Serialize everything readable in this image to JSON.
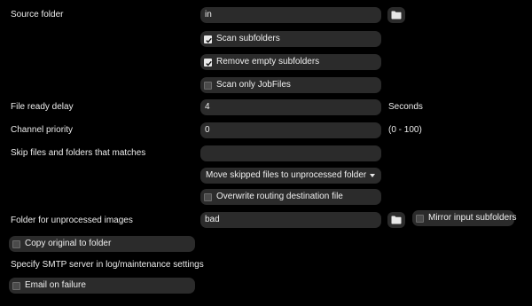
{
  "source_folder": {
    "label": "Source folder",
    "value": "in",
    "browse_icon": "folder-icon"
  },
  "scan_subfolders": {
    "label": "Scan subfolders",
    "checked": true
  },
  "remove_empty_subfolders": {
    "label": "Remove empty subfolders",
    "checked": true
  },
  "scan_only_jobfiles": {
    "label": "Scan only JobFiles",
    "checked": false
  },
  "file_ready_delay": {
    "label": "File ready delay",
    "value": "4",
    "unit": "Seconds"
  },
  "channel_priority": {
    "label": "Channel priority",
    "value": "0",
    "range": "(0 - 100)"
  },
  "skip_files": {
    "label": "Skip files and folders that matches",
    "value": "",
    "action_selected": "Move skipped files to unprocessed folder"
  },
  "overwrite_routing": {
    "label": "Overwrite routing destination file",
    "checked": false
  },
  "unprocessed_folder": {
    "label": "Folder for unprocessed images",
    "value": "bad",
    "browse_icon": "folder-icon"
  },
  "mirror_input_subfolders": {
    "label": "Mirror input subfolders",
    "checked": false
  },
  "copy_original": {
    "label": "Copy original to folder",
    "checked": false
  },
  "smtp_note": "Specify SMTP server in log/maintenance settings",
  "email_on_failure": {
    "label": "Email on failure",
    "checked": false
  },
  "colors": {
    "background": "#000000",
    "control": "#2b2b2b",
    "text": "#ececec"
  }
}
